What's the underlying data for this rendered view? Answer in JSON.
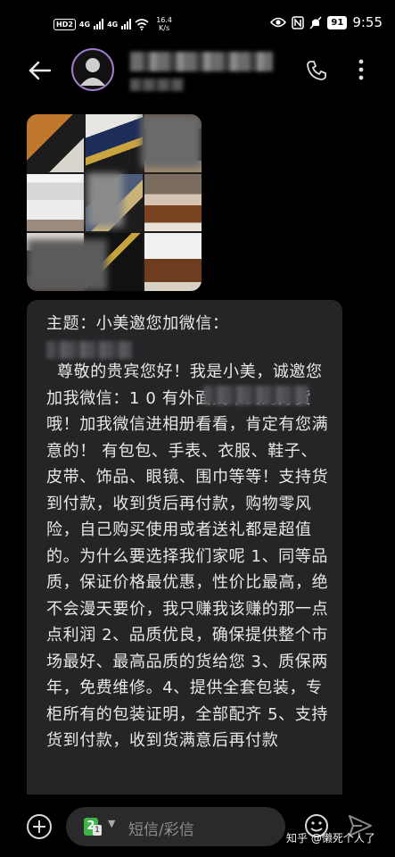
{
  "status_bar": {
    "hd_label": "HD",
    "hd_num": "2",
    "net1": "4G",
    "net2": "4G",
    "speed_value": "16.4",
    "speed_unit": "K/s",
    "battery": "91",
    "time": "9:55"
  },
  "conversation": {
    "contact_name_redacted": true,
    "message_subject": "主题：小美邀您加微信：",
    "message_body": "尊敬的贵宾您好！我是小美，诚邀您加我微信：1                0 有外面找不到的好货哦！加我微信进相册看看，肯定有您满意的！ 有包包、手表、衣服、鞋子、皮带、饰品、眼镜、围巾等等！支持货到付款，收到货后再付款，购物零风险，自己购买使用或者送礼都是超值的。为什么要选择我们家呢 1、同等品质，保证价格最优惠，性价比最高，绝不会漫天要价，我只赚我该赚的那一点点利润 2、品质优良，确保提供整个市场最好、最高品质的货给您 3、质保两年，免费维修。4、提供全套包装，专柜所有的包装证明，全部配齐 5、支持货到付款，收到货满意后再付款"
  },
  "composer": {
    "sim_number": "2",
    "sim_sub": "1",
    "placeholder": "短信/彩信"
  },
  "watermark": "知乎 @懒死个人了",
  "icons": [
    "back-arrow-icon",
    "phone-icon",
    "more-vert-icon",
    "add-icon",
    "emoji-icon",
    "send-icon",
    "wifi-icon",
    "eye-icon",
    "nfc-icon",
    "mute-icon"
  ],
  "colors": {
    "background": "#000000",
    "bubble": "#252527",
    "avatar_ring": "#9d7cc9",
    "sim_badge": "#3fb549"
  }
}
